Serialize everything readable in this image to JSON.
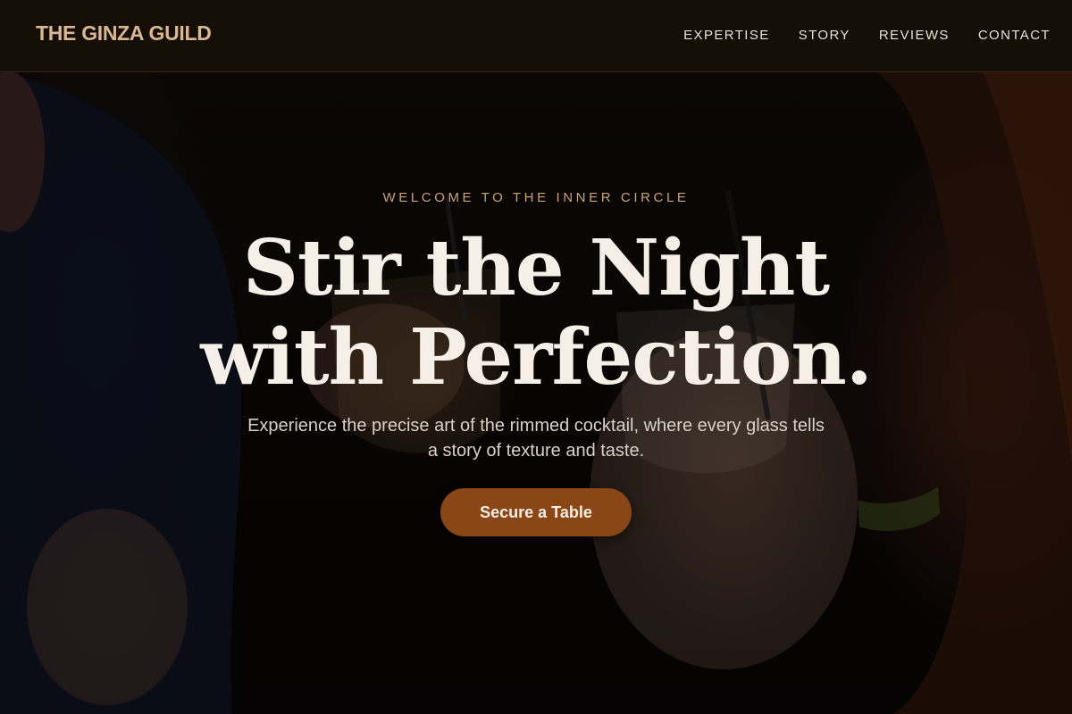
{
  "header": {
    "brand": "THE GINZA GUILD",
    "nav": [
      {
        "label": "EXPERTISE"
      },
      {
        "label": "STORY"
      },
      {
        "label": "REVIEWS"
      },
      {
        "label": "CONTACT"
      }
    ]
  },
  "hero": {
    "eyebrow": "WELCOME TO THE INNER CIRCLE",
    "headline_line_1": "Stir the Night",
    "headline_line_2": "with Perfection.",
    "lede": "Experience the precise art of the rimmed cocktail, where every glass tells a story of texture and taste.",
    "cta_label": "Secure a Table"
  },
  "colors": {
    "header_bg": "#170f07",
    "brand": "#d8b791",
    "accent": "#8a4616",
    "eyebrow": "#c9a37a",
    "headline": "#f6efe7"
  }
}
